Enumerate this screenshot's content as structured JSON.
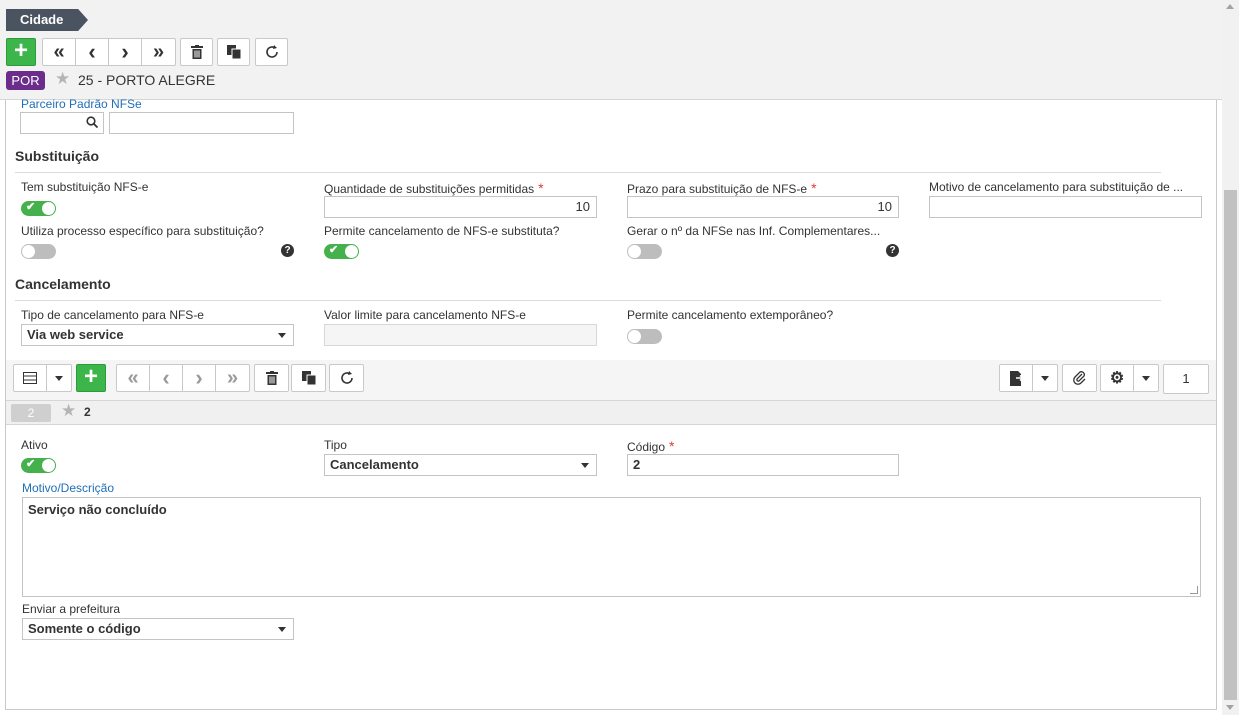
{
  "breadcrumb": "Cidade",
  "toolbar": {
    "add": "+",
    "first": "«",
    "prev": "‹",
    "next": "›",
    "last": "»"
  },
  "record": {
    "tag": "POR",
    "title": "25 - PORTO ALEGRE"
  },
  "partner": {
    "label": "Parceiro Padrão NFSe",
    "code": "",
    "name": ""
  },
  "substituicao": {
    "title": "Substituição",
    "tem_substituicao": {
      "label": "Tem substituição NFS-e",
      "on": true
    },
    "quantidade": {
      "label": "Quantidade de substituições permitidas",
      "value": "10"
    },
    "prazo": {
      "label": "Prazo para substituição de NFS-e",
      "value": "10"
    },
    "motivo": {
      "label": "Motivo de cancelamento para substituição de ...",
      "value": ""
    },
    "processo_especifico": {
      "label": "Utiliza processo específico para substituição?",
      "on": false
    },
    "permite_cancelamento": {
      "label": "Permite cancelamento de NFS-e substituta?",
      "on": true
    },
    "gerar_numero": {
      "label": "Gerar o nº da NFSe nas Inf. Complementares...",
      "on": false
    }
  },
  "cancelamento": {
    "title": "Cancelamento",
    "tipo": {
      "label": "Tipo de cancelamento para NFS-e",
      "value": "Via web service"
    },
    "valor_limite": {
      "label": "Valor limite para cancelamento NFS-e",
      "value": ""
    },
    "extemporaneo": {
      "label": "Permite cancelamento extemporâneo?",
      "on": false
    }
  },
  "subgrid": {
    "page": "1",
    "record_tag": "2",
    "record_title": "2",
    "ativo": {
      "label": "Ativo",
      "on": true
    },
    "tipo": {
      "label": "Tipo",
      "value": "Cancelamento"
    },
    "codigo": {
      "label": "Código",
      "value": "2"
    },
    "motivo": {
      "label": "Motivo/Descrição",
      "value": "Serviço não concluído"
    },
    "enviar": {
      "label": "Enviar a prefeitura",
      "value": "Somente o código"
    }
  },
  "colors": {
    "accent_green": "#3cb54a",
    "tag_purple": "#6b2c8c",
    "breadcrumb_bg": "#4a5360",
    "link_blue": "#1f6fb8",
    "required_red": "#e03a3a"
  }
}
